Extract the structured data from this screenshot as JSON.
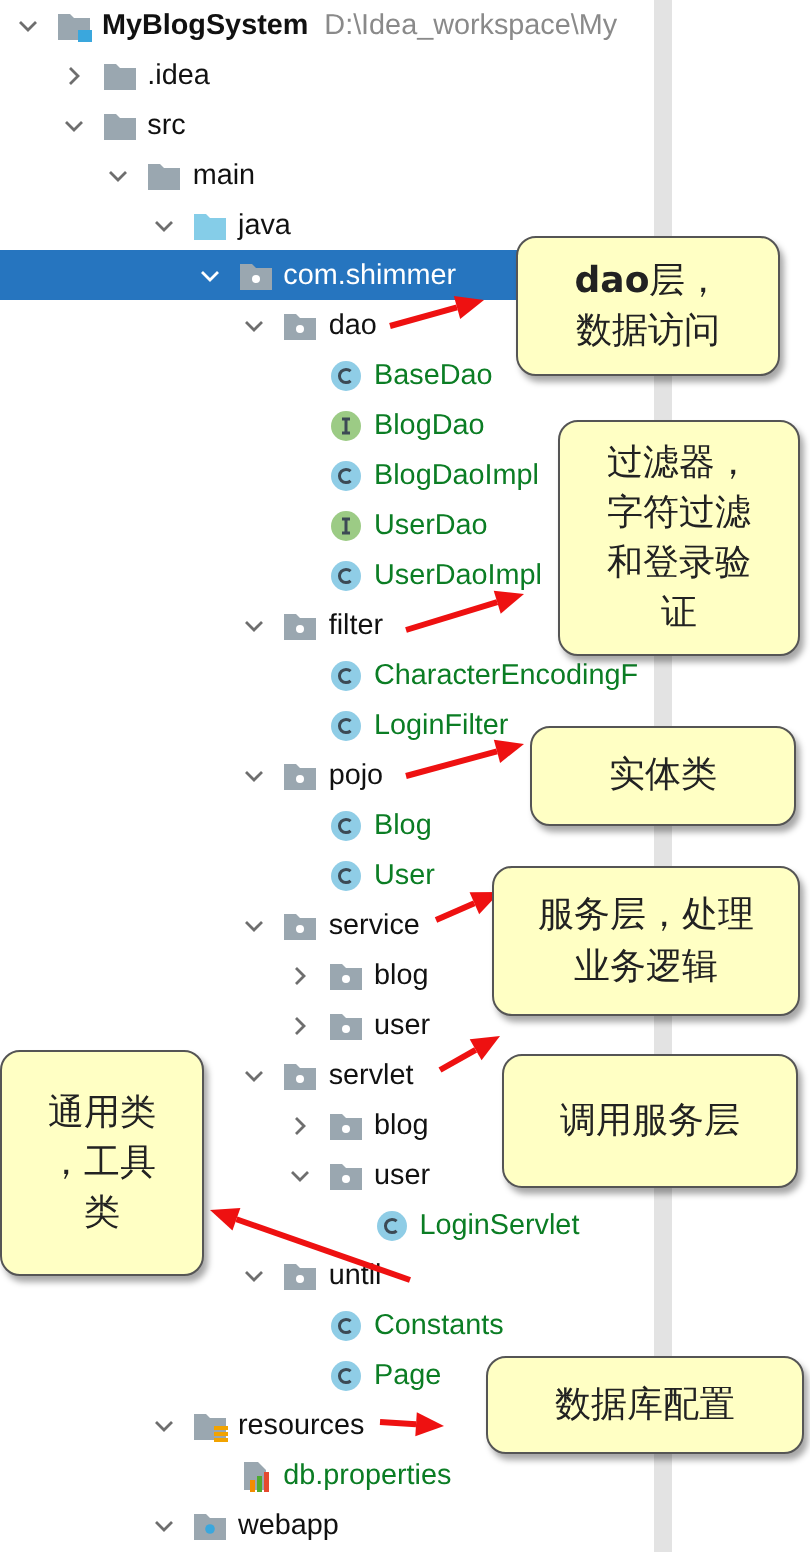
{
  "tree": [
    {
      "name": "MyBlogSystem",
      "path": "D:\\Idea_workspace\\My",
      "kind": "module",
      "expanded": true,
      "selected": false,
      "children": [
        {
          "name": ".idea",
          "kind": "folder",
          "expanded": false,
          "selected": false
        },
        {
          "name": "src",
          "kind": "folder",
          "expanded": true,
          "selected": false,
          "children": [
            {
              "name": "main",
              "kind": "folder",
              "expanded": true,
              "selected": false,
              "children": [
                {
                  "name": "java",
                  "kind": "source-folder",
                  "expanded": true,
                  "selected": false,
                  "children": [
                    {
                      "name": "com.shimmer",
                      "kind": "package",
                      "expanded": true,
                      "selected": true,
                      "children": [
                        {
                          "name": "dao",
                          "kind": "package",
                          "expanded": true,
                          "selected": false,
                          "children": [
                            {
                              "name": "BaseDao",
                              "kind": "class",
                              "selected": false
                            },
                            {
                              "name": "BlogDao",
                              "kind": "interface",
                              "selected": false
                            },
                            {
                              "name": "BlogDaoImpl",
                              "kind": "class",
                              "selected": false
                            },
                            {
                              "name": "UserDao",
                              "kind": "interface",
                              "selected": false
                            },
                            {
                              "name": "UserDaoImpl",
                              "kind": "class",
                              "selected": false
                            }
                          ]
                        },
                        {
                          "name": "filter",
                          "kind": "package",
                          "expanded": true,
                          "selected": false,
                          "children": [
                            {
                              "name": "CharacterEncodingF",
                              "kind": "class",
                              "selected": false
                            },
                            {
                              "name": "LoginFilter",
                              "kind": "class",
                              "selected": false
                            }
                          ]
                        },
                        {
                          "name": "pojo",
                          "kind": "package",
                          "expanded": true,
                          "selected": false,
                          "children": [
                            {
                              "name": "Blog",
                              "kind": "class",
                              "selected": false
                            },
                            {
                              "name": "User",
                              "kind": "class",
                              "selected": false
                            }
                          ]
                        },
                        {
                          "name": "service",
                          "kind": "package",
                          "expanded": true,
                          "selected": false,
                          "children": [
                            {
                              "name": "blog",
                              "kind": "package",
                              "expanded": false,
                              "selected": false
                            },
                            {
                              "name": "user",
                              "kind": "package",
                              "expanded": false,
                              "selected": false
                            }
                          ]
                        },
                        {
                          "name": "servlet",
                          "kind": "package",
                          "expanded": true,
                          "selected": false,
                          "children": [
                            {
                              "name": "blog",
                              "kind": "package",
                              "expanded": false,
                              "selected": false
                            },
                            {
                              "name": "user",
                              "kind": "package",
                              "expanded": true,
                              "selected": false,
                              "children": [
                                {
                                  "name": "LoginServlet",
                                  "kind": "class",
                                  "selected": false
                                }
                              ]
                            }
                          ]
                        },
                        {
                          "name": "until",
                          "kind": "package",
                          "expanded": true,
                          "selected": false,
                          "children": [
                            {
                              "name": "Constants",
                              "kind": "class",
                              "selected": false
                            },
                            {
                              "name": "Page",
                              "kind": "class",
                              "selected": false
                            }
                          ]
                        }
                      ]
                    }
                  ]
                },
                {
                  "name": "resources",
                  "kind": "resources-folder",
                  "expanded": true,
                  "selected": false,
                  "children": [
                    {
                      "name": "db.properties",
                      "kind": "properties",
                      "selected": false
                    }
                  ]
                },
                {
                  "name": "webapp",
                  "kind": "web-folder",
                  "expanded": true,
                  "selected": false
                }
              ]
            }
          ]
        }
      ]
    }
  ],
  "callouts": [
    {
      "lines": [
        "**dao**层，",
        "数据访问"
      ]
    },
    {
      "lines": [
        "过滤器，",
        "字符过滤",
        "和登录验",
        "证"
      ]
    },
    {
      "lines": [
        "实体类"
      ]
    },
    {
      "lines": [
        "服务层，处理",
        "业务逻辑"
      ]
    },
    {
      "lines": [
        "通用类",
        "，工具",
        "类"
      ]
    },
    {
      "lines": [
        "调用服务层"
      ]
    },
    {
      "lines": [
        "数据库配置"
      ]
    }
  ]
}
